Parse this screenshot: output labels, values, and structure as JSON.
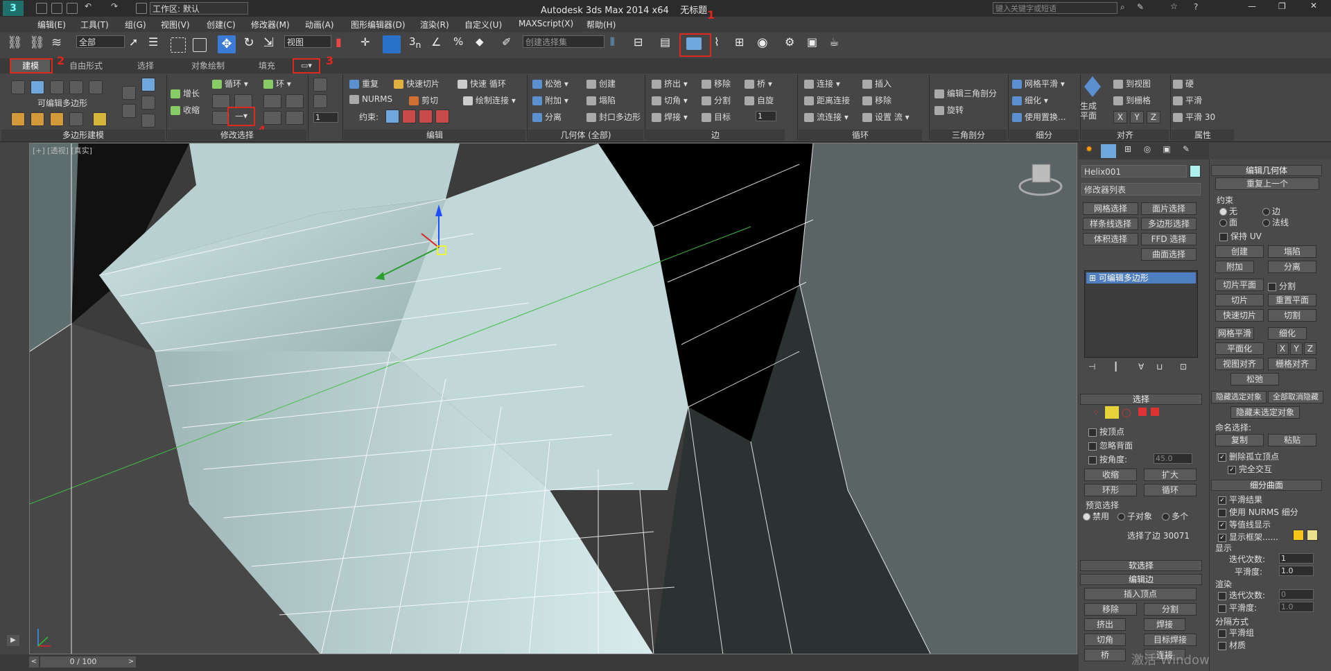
{
  "titlebar": {
    "app_title": "Autodesk 3ds Max  2014 x64",
    "doc_title": "无标题",
    "workspace": "工作区: 默认",
    "search_placeholder": "键入关键字或短语"
  },
  "menu": [
    "编辑(E)",
    "工具(T)",
    "组(G)",
    "视图(V)",
    "创建(C)",
    "修改器(M)",
    "动画(A)",
    "图形编辑器(D)",
    "渲染(R)",
    "自定义(U)",
    "MAXScript(X)",
    "帮助(H)"
  ],
  "toolbar": {
    "filter_value": "全部",
    "refcoord_value": "视图",
    "selset_placeholder": "创建选择集"
  },
  "annotations": [
    "1",
    "2",
    "3",
    "4"
  ],
  "ribbon_tabs": [
    "建模",
    "自由形式",
    "选择",
    "对象绘制",
    "填充"
  ],
  "ribbon": {
    "polymod_label": "可编辑多边形",
    "groups": {
      "polymod": "多边形建模",
      "modsel": "修改选择",
      "edit": "编辑",
      "geom": "几何体 (全部)",
      "edges": "边",
      "loops": "循环",
      "tris": "三角剖分",
      "subdiv": "细分",
      "align": "对齐",
      "props": "属性"
    },
    "modsel": {
      "grow": "增长",
      "shrink": "收缩",
      "loop": "循环",
      "ring": "环"
    },
    "edit": {
      "repeat": "重复",
      "quickslice": "快速切片",
      "quickloop": "快速 循环",
      "nurms": "NURMS",
      "cut": "剪切",
      "paintconnect": "绘制连接",
      "constraint": "约束:"
    },
    "geom": {
      "relax": "松弛",
      "create": "创建",
      "attach": "附加",
      "collapse": "塌陷",
      "detach": "分离",
      "cap": "封口多边形"
    },
    "edges": {
      "extrude": "挤出",
      "remove": "移除",
      "bridge": "桥",
      "chamfer": "切角",
      "split": "分割",
      "spin": "自旋",
      "weld": "焊接",
      "target": "目标",
      "spin_value": "1"
    },
    "loops": {
      "connect": "连接",
      "insert": "插入",
      "distconnect": "距离连接",
      "remove": "移除",
      "flowconnect": "流连接",
      "setflow": "设置 流"
    },
    "tris": {
      "edittri": "编辑三角剖分",
      "turn": "旋转"
    },
    "subdiv": {
      "meshsmooth": "网格平滑",
      "tessellate": "细化",
      "usedisp": "使用置换..."
    },
    "align": {
      "genplane": "生成平面",
      "toview": "到视图",
      "togrid": "到栅格",
      "x": "X",
      "y": "Y",
      "z": "Z"
    },
    "props": {
      "hard": "硬",
      "smooth": "平滑",
      "smooth30": "平滑 30"
    },
    "spin_value": "1"
  },
  "viewport": {
    "label": "[+] [透视] [真实]"
  },
  "timeline": {
    "frame": "0 / 100"
  },
  "cmdpanel": {
    "object_name": "Helix001",
    "modlist": "修改器列表",
    "buttons": [
      "网格选择",
      "面片选择",
      "样条线选择",
      "多边形选择",
      "体积选择",
      "FFD 选择",
      "曲面选择"
    ],
    "stack_item": "可编辑多边形",
    "selection": {
      "header": "选择",
      "by_vertex": "按顶点",
      "ignore_back": "忽略背面",
      "by_angle": "按角度:",
      "angle_value": "45.0",
      "shrink": "收缩",
      "grow": "扩大",
      "ring": "环形",
      "loop": "循环",
      "preview": "预览选择",
      "disabled": "禁用",
      "subobj": "子对象",
      "multi": "多个",
      "status": "选择了边 30071"
    },
    "soft_sel": "软选择",
    "edit_edges": {
      "header": "编辑边",
      "insert_vertex": "插入顶点",
      "remove": "移除",
      "split": "分割",
      "extrude": "挤出",
      "weld": "焊接",
      "chamfer": "切角",
      "target_weld": "目标焊接",
      "bridge": "桥",
      "connect": "连接"
    },
    "watermark": "激活 Windows"
  },
  "editgeom": {
    "header": "编辑几何体",
    "repeat": "重复上一个",
    "constraints": "约束",
    "c_none": "无",
    "c_edge": "边",
    "c_face": "面",
    "c_normal": "法线",
    "keep_uv": "保持 UV",
    "create": "创建",
    "collapse": "塌陷",
    "attach": "附加",
    "detach": "分离",
    "sliceplane": "切片平面",
    "split": "分割",
    "slice": "切片",
    "reset_plane": "重置平面",
    "quickslice": "快速切片",
    "cut": "切割",
    "meshsmooth": "网格平滑",
    "tessellate": "细化",
    "planarize": "平面化",
    "x": "X",
    "y": "Y",
    "z": "Z",
    "view_align": "视图对齐",
    "grid_align": "栅格对齐",
    "relax": "松弛",
    "hide_sel": "隐藏选定对象",
    "unhide_all": "全部取消隐藏",
    "hide_unsel": "隐藏未选定对象",
    "named_sel": "命名选择:",
    "copy": "复制",
    "paste": "粘贴",
    "del_iso": "删除孤立顶点",
    "full_interact": "完全交互"
  },
  "subdivsurf": {
    "header": "细分曲面",
    "smooth_result": "平滑结果",
    "use_nurms": "使用 NURMS 细分",
    "isoline": "等值线显示",
    "show_cage": "显示框架......",
    "display": "显示",
    "iter": "迭代次数:",
    "iter_value": "1",
    "smoothness": "平滑度:",
    "smooth_value": "1.0",
    "render": "渲染",
    "r_iter_value": "0",
    "r_smooth_value": "1.0",
    "sep_by": "分隔方式",
    "smooth_groups": "平滑组",
    "materials": "材质"
  }
}
